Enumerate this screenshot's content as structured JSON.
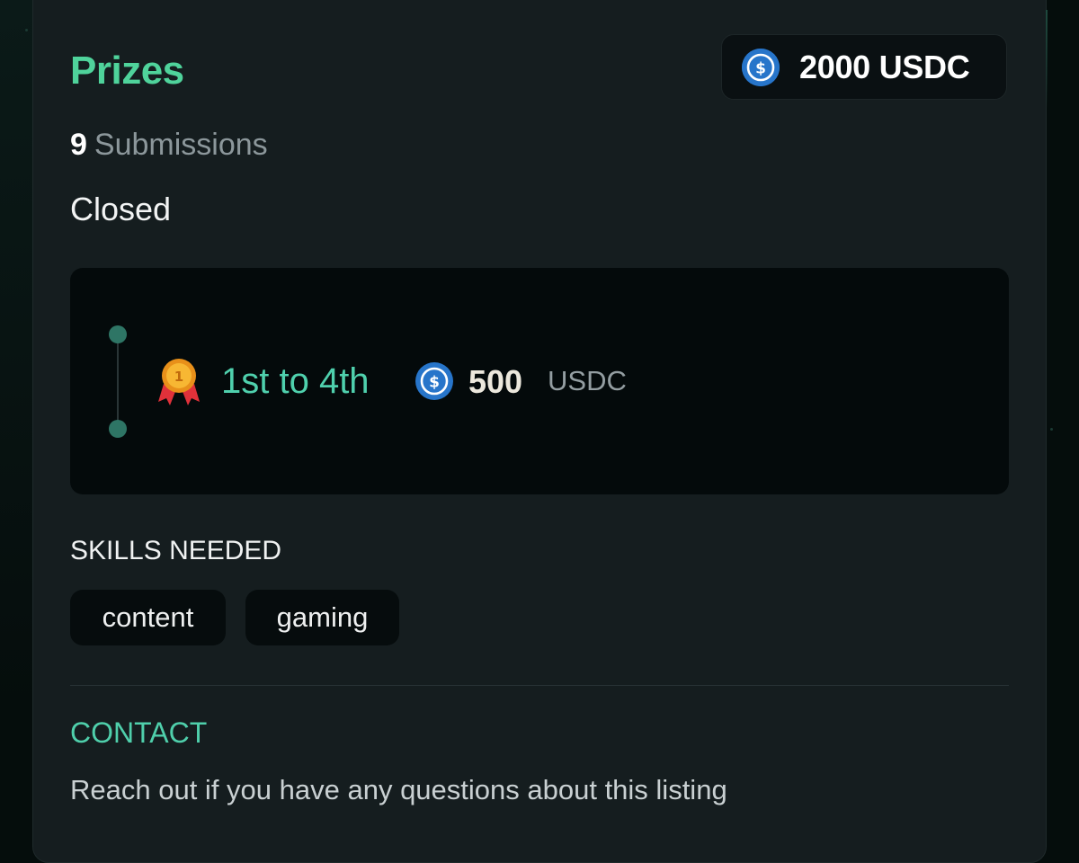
{
  "prizes": {
    "title": "Prizes",
    "total_amount": "2000 USDC",
    "total_icon": "usdc-coin-icon"
  },
  "submissions": {
    "count": "9",
    "label": "Submissions"
  },
  "status": "Closed",
  "prize_tiers": [
    {
      "icon": "medal-icon",
      "rank": "1st to 4th",
      "coin_icon": "usdc-coin-icon",
      "amount": "500",
      "unit": "USDC"
    }
  ],
  "skills": {
    "heading": "SKILLS NEEDED",
    "items": [
      "content",
      "gaming"
    ]
  },
  "contact": {
    "heading": "CONTACT",
    "text": "Reach out if you have any questions about this listing"
  },
  "colors": {
    "accent_green": "#4fd39b",
    "teal": "#4fd0ad",
    "usdc_blue": "#2775ca",
    "card_bg": "#151d1f"
  }
}
